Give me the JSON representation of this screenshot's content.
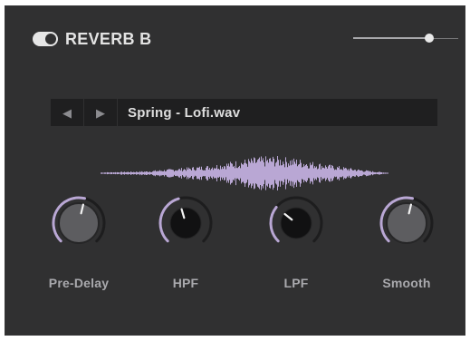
{
  "theme": {
    "background": "#303031",
    "accent": "#b9a7d4",
    "text": "#e3e3e3",
    "muted": "#a9a9ad"
  },
  "header": {
    "title": "REVERB B",
    "enabled": true,
    "mix_level": 0.72
  },
  "file_bar": {
    "prev_icon": "chevron-left-icon",
    "next_icon": "chevron-right-icon",
    "prev_symbol": "◀",
    "next_symbol": "▶",
    "file_name": "Spring - Lofi.wav"
  },
  "knobs": [
    {
      "label": "Pre-Delay",
      "value": 0.55,
      "style": "large"
    },
    {
      "label": "HPF",
      "value": 0.44,
      "style": "small"
    },
    {
      "label": "LPF",
      "value": 0.31,
      "style": "small"
    },
    {
      "label": "Smooth",
      "value": 0.55,
      "style": "large"
    }
  ]
}
